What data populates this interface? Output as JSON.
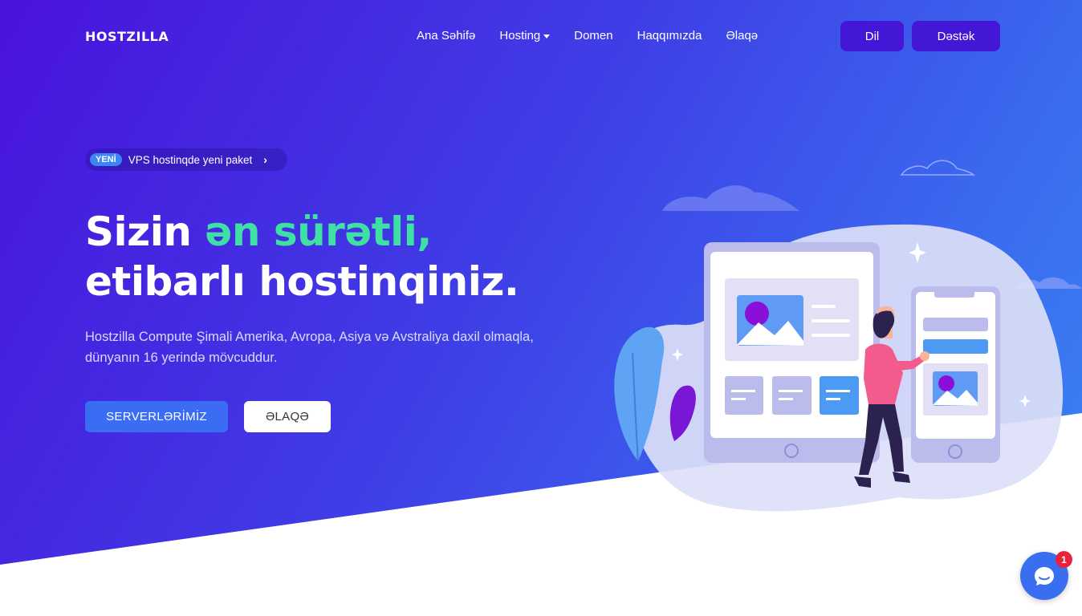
{
  "header": {
    "logo": "HOSTZILLA",
    "nav": [
      "Ana Səhifə",
      "Hosting",
      "Domen",
      "Haqqımızda",
      "Əlaqə"
    ],
    "lang_button": "Dil",
    "support_button": "Dəstək"
  },
  "hero": {
    "badge_tag": "YENİ",
    "badge_text": "VPS hostinqde yeni paket",
    "title_line1_start": "Sizin ",
    "title_line1_accent": "ən sürətli,",
    "title_line2": "etibarlı hostinqiniz.",
    "description": "Hostzilla Compute Şimali Amerika, Avropa, Asiya və Avstraliya daxil olmaqla, dünyanın 16 yerində mövcuddur.",
    "cta_primary": "SERVERLƏRİMİZ",
    "cta_secondary": "ƏLAQƏ"
  },
  "chat": {
    "unread_count": "1"
  },
  "colors": {
    "gradient_start": "#4a12dc",
    "gradient_end": "#3a86f2",
    "accent_green": "#3fe0a4",
    "button_dark": "#4417d6",
    "badge_red": "#e8223a"
  },
  "icons": {
    "nav_dropdown": "caret-down-icon",
    "badge_arrow": "chevron-right-icon",
    "chat": "chat-bubble-icon"
  }
}
